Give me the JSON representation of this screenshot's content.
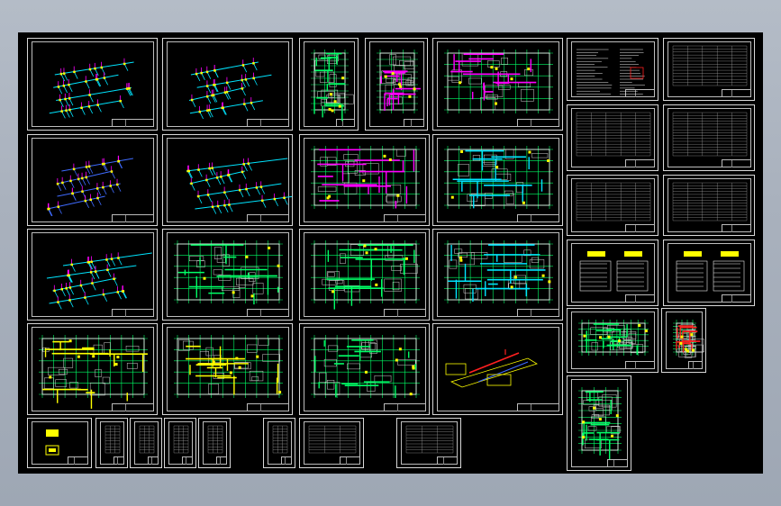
{
  "viewport": {
    "background_color": "#000000",
    "frame_color": "#d8d8d8"
  },
  "palette": {
    "grid": "#00ff66",
    "cyan": "#00e5ff",
    "magenta": "#ff00ff",
    "yellow": "#ffff00",
    "blue": "#3f6bff",
    "red": "#ff2020",
    "white": "#e8e8e8"
  },
  "sheets": [
    {
      "id": "s01",
      "kind": "iso",
      "accent": "#00e5ff"
    },
    {
      "id": "s02",
      "kind": "iso",
      "accent": "#00e5ff"
    },
    {
      "id": "s03",
      "kind": "plan-tall",
      "accent": "#00ff66"
    },
    {
      "id": "s04",
      "kind": "plan-tall",
      "accent": "#ff00ff"
    },
    {
      "id": "s05",
      "kind": "plan",
      "accent": "#ff00ff"
    },
    {
      "id": "s06",
      "kind": "notes",
      "accent": "#e8e8e8"
    },
    {
      "id": "s07",
      "kind": "table",
      "accent": "#e8e8e8"
    },
    {
      "id": "s08",
      "kind": "iso",
      "accent": "#3f6bff"
    },
    {
      "id": "s09",
      "kind": "iso",
      "accent": "#00e5ff"
    },
    {
      "id": "s10",
      "kind": "plan",
      "accent": "#ff00ff"
    },
    {
      "id": "s11",
      "kind": "plan",
      "accent": "#00e5ff"
    },
    {
      "id": "s12",
      "kind": "table",
      "accent": "#e8e8e8"
    },
    {
      "id": "s13",
      "kind": "table",
      "accent": "#e8e8e8"
    },
    {
      "id": "s14",
      "kind": "iso",
      "accent": "#00e5ff"
    },
    {
      "id": "s15",
      "kind": "plan",
      "accent": "#00ff66"
    },
    {
      "id": "s16",
      "kind": "plan",
      "accent": "#00ff66"
    },
    {
      "id": "s17",
      "kind": "plan",
      "accent": "#00e5ff"
    },
    {
      "id": "s18",
      "kind": "table",
      "accent": "#e8e8e8"
    },
    {
      "id": "s19",
      "kind": "table",
      "accent": "#e8e8e8"
    },
    {
      "id": "s20",
      "kind": "legend",
      "accent": "#ffff00"
    },
    {
      "id": "s21",
      "kind": "legend",
      "accent": "#ffff00"
    },
    {
      "id": "s22",
      "kind": "plan",
      "accent": "#ffff00"
    },
    {
      "id": "s23",
      "kind": "plan",
      "accent": "#ffff00"
    },
    {
      "id": "s24",
      "kind": "plan",
      "accent": "#00ff66"
    },
    {
      "id": "s25",
      "kind": "iso3d",
      "accent": "#ffff00"
    },
    {
      "id": "s26",
      "kind": "section",
      "accent": "#00ff66"
    },
    {
      "id": "s27",
      "kind": "section-tall",
      "accent": "#ff2020"
    },
    {
      "id": "s28",
      "kind": "symbol",
      "accent": "#ffff00"
    },
    {
      "id": "s29",
      "kind": "table",
      "accent": "#e8e8e8"
    },
    {
      "id": "s30",
      "kind": "table",
      "accent": "#e8e8e8"
    },
    {
      "id": "s31",
      "kind": "table",
      "accent": "#e8e8e8"
    },
    {
      "id": "s32",
      "kind": "table",
      "accent": "#e8e8e8"
    },
    {
      "id": "s33",
      "kind": "table",
      "accent": "#e8e8e8"
    },
    {
      "id": "s34",
      "kind": "table",
      "accent": "#e8e8e8"
    },
    {
      "id": "s35",
      "kind": "table",
      "accent": "#e8e8e8"
    },
    {
      "id": "s36",
      "kind": "plan-tall",
      "accent": "#00ff66"
    }
  ]
}
